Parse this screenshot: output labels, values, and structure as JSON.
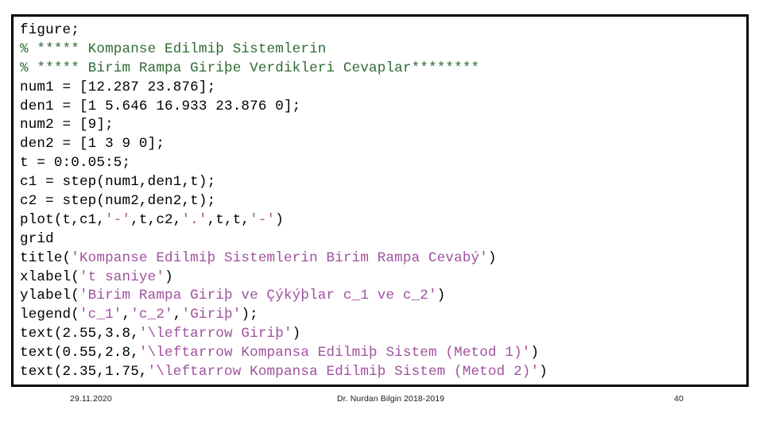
{
  "slide": {
    "background_color": "#ffffff",
    "border_color": "#000000"
  },
  "colors": {
    "plain": "#000000",
    "comment": "#2f6b34",
    "string": "#a0529f"
  },
  "code": {
    "language": "matlab",
    "lines": [
      [
        {
          "t": "figure;",
          "c": "plain"
        }
      ],
      [
        {
          "t": "% ***** ",
          "c": "comment"
        },
        {
          "t": "Kompanse Edilmiþ Sistemlerin",
          "c": "comment"
        }
      ],
      [
        {
          "t": "% ***** ",
          "c": "comment"
        },
        {
          "t": "Birim Rampa Giriþe Verdikleri Cevaplar********",
          "c": "comment"
        }
      ],
      [
        {
          "t": "num1 = [12.287 23.876];",
          "c": "plain"
        }
      ],
      [
        {
          "t": "den1 = [1 5.646 16.933 23.876 0];",
          "c": "plain"
        }
      ],
      [
        {
          "t": "num2 = [9];",
          "c": "plain"
        }
      ],
      [
        {
          "t": "den2 = [1 3 9 0];",
          "c": "plain"
        }
      ],
      [
        {
          "t": "t = 0:0.05:5;",
          "c": "plain"
        }
      ],
      [
        {
          "t": "c1 = step(num1,den1,t);",
          "c": "plain"
        }
      ],
      [
        {
          "t": "c2 = step(num2,den2,t);",
          "c": "plain"
        }
      ],
      [
        {
          "t": "plot(t,c1,",
          "c": "plain"
        },
        {
          "t": "'-'",
          "c": "string"
        },
        {
          "t": ",t,c2,",
          "c": "plain"
        },
        {
          "t": "'.'",
          "c": "string"
        },
        {
          "t": ",t,t,",
          "c": "plain"
        },
        {
          "t": "'-'",
          "c": "string"
        },
        {
          "t": ")",
          "c": "plain"
        }
      ],
      [
        {
          "t": "grid",
          "c": "plain"
        }
      ],
      [
        {
          "t": "title(",
          "c": "plain"
        },
        {
          "t": "'Kompanse Edilmiþ Sistemlerin Birim Rampa Cevabý'",
          "c": "string"
        },
        {
          "t": ")",
          "c": "plain"
        }
      ],
      [
        {
          "t": "xlabel(",
          "c": "plain"
        },
        {
          "t": "'t saniye'",
          "c": "string"
        },
        {
          "t": ")",
          "c": "plain"
        }
      ],
      [
        {
          "t": "ylabel(",
          "c": "plain"
        },
        {
          "t": "'Birim Rampa Giriþ ve Çýkýþlar c_1 ve c_2'",
          "c": "string"
        },
        {
          "t": ")",
          "c": "plain"
        }
      ],
      [
        {
          "t": "legend(",
          "c": "plain"
        },
        {
          "t": "'c_1'",
          "c": "string"
        },
        {
          "t": ",",
          "c": "plain"
        },
        {
          "t": "'c_2'",
          "c": "string"
        },
        {
          "t": ",",
          "c": "plain"
        },
        {
          "t": "'Giriþ'",
          "c": "string"
        },
        {
          "t": ");",
          "c": "plain"
        }
      ],
      [
        {
          "t": "text(2.55,3.8,",
          "c": "plain"
        },
        {
          "t": "'\\leftarrow Giriþ'",
          "c": "string"
        },
        {
          "t": ")",
          "c": "plain"
        }
      ],
      [
        {
          "t": "text(0.55,2.8,",
          "c": "plain"
        },
        {
          "t": "'\\leftarrow Kompansa Edilmiþ Sistem (Metod 1)'",
          "c": "string"
        },
        {
          "t": ")",
          "c": "plain"
        }
      ],
      [
        {
          "t": "text(2.35,1.75,",
          "c": "plain"
        },
        {
          "t": "'\\leftarrow Kompansa Edilmiþ Sistem (Metod 2)'",
          "c": "string"
        },
        {
          "t": ")",
          "c": "plain"
        }
      ]
    ]
  },
  "footer": {
    "date": "29.11.2020",
    "author": "Dr. Nurdan Bilgin 2018-2019",
    "page_number": "40"
  }
}
